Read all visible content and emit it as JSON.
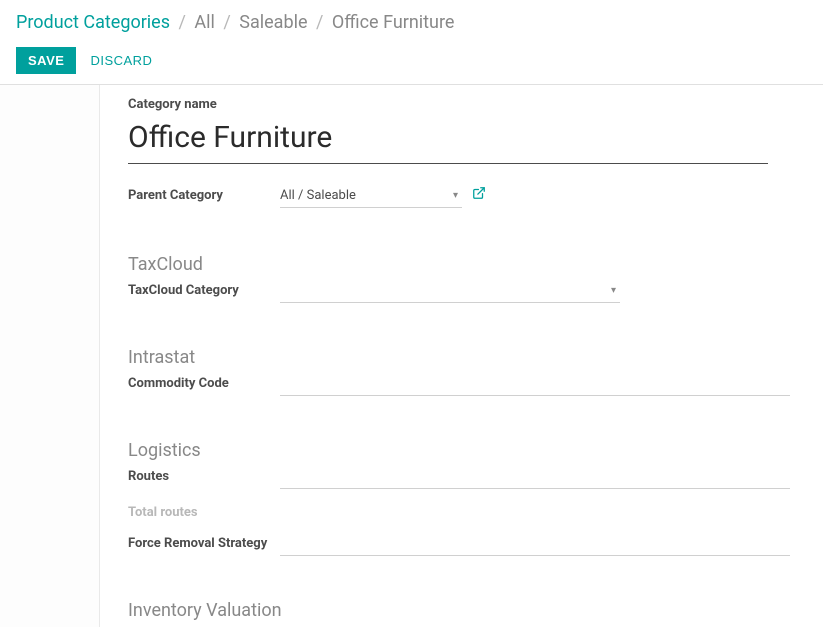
{
  "breadcrumb": {
    "root": "Product Categories",
    "path": [
      "All",
      "Saleable",
      "Office Furniture"
    ]
  },
  "actions": {
    "save": "SAVE",
    "discard": "DISCARD"
  },
  "fields": {
    "category_name_label": "Category name",
    "category_name_value": "Office Furniture",
    "parent_category_label": "Parent Category",
    "parent_category_value": "All / Saleable"
  },
  "sections": {
    "taxcloud": {
      "title": "TaxCloud",
      "category_label": "TaxCloud Category",
      "category_value": ""
    },
    "intrastat": {
      "title": "Intrastat",
      "commodity_code_label": "Commodity Code",
      "commodity_code_value": ""
    },
    "logistics": {
      "title": "Logistics",
      "routes_label": "Routes",
      "routes_value": "",
      "total_routes_label": "Total routes",
      "force_removal_label": "Force Removal Strategy",
      "force_removal_value": ""
    },
    "inventory_valuation": {
      "title": "Inventory Valuation"
    }
  }
}
